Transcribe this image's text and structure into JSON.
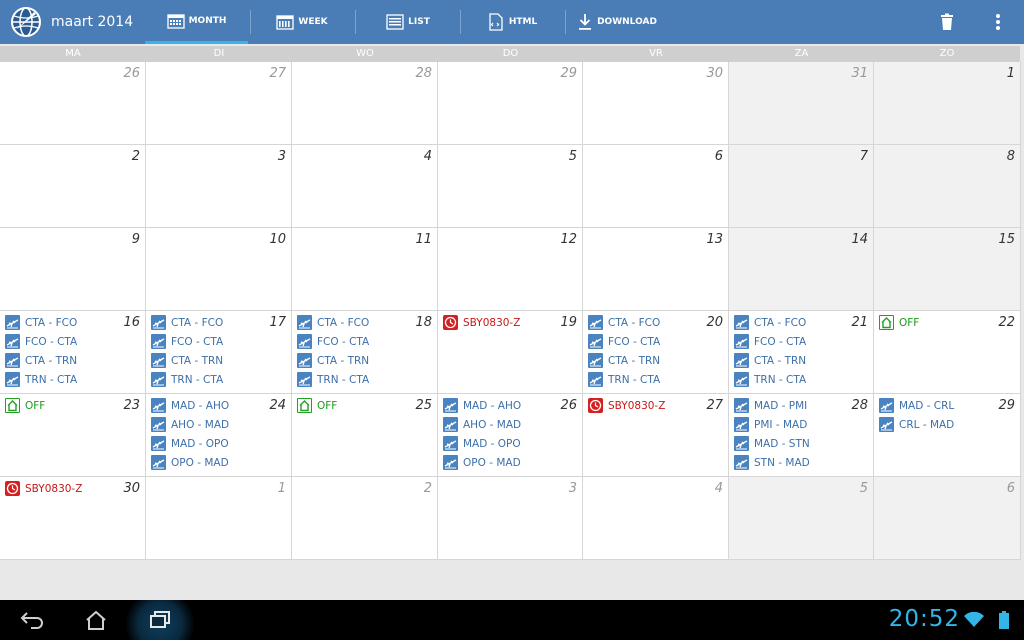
{
  "header": {
    "title": "maart 2014",
    "nav": [
      {
        "label": "MONTH",
        "icon": "calendar-month-icon",
        "active": true
      },
      {
        "label": "WEEK",
        "icon": "calendar-week-icon",
        "active": false
      },
      {
        "label": "LIST",
        "icon": "list-icon",
        "active": false
      },
      {
        "label": "HTML",
        "icon": "html-export-icon",
        "active": false
      },
      {
        "label": "DOWNLOAD",
        "icon": "download-icon",
        "active": false
      }
    ],
    "actions": [
      "trash-icon",
      "overflow-menu-icon"
    ]
  },
  "calendar": {
    "days_of_week": [
      "MA",
      "DI",
      "WO",
      "DO",
      "VR",
      "ZA",
      "ZO"
    ],
    "weeks": [
      [
        {
          "day": "26",
          "other": true,
          "events": []
        },
        {
          "day": "27",
          "other": true,
          "events": []
        },
        {
          "day": "28",
          "other": true,
          "events": []
        },
        {
          "day": "29",
          "other": true,
          "events": []
        },
        {
          "day": "30",
          "other": true,
          "events": []
        },
        {
          "day": "31",
          "other": true,
          "events": []
        },
        {
          "day": "1",
          "other": false,
          "events": []
        }
      ],
      [
        {
          "day": "2",
          "other": false,
          "events": []
        },
        {
          "day": "3",
          "other": false,
          "events": []
        },
        {
          "day": "4",
          "other": false,
          "events": []
        },
        {
          "day": "5",
          "other": false,
          "events": []
        },
        {
          "day": "6",
          "other": false,
          "events": []
        },
        {
          "day": "7",
          "other": false,
          "events": []
        },
        {
          "day": "8",
          "other": false,
          "events": []
        }
      ],
      [
        {
          "day": "9",
          "other": false,
          "events": []
        },
        {
          "day": "10",
          "other": false,
          "events": []
        },
        {
          "day": "11",
          "other": false,
          "events": []
        },
        {
          "day": "12",
          "other": false,
          "events": []
        },
        {
          "day": "13",
          "other": false,
          "events": []
        },
        {
          "day": "14",
          "other": false,
          "events": []
        },
        {
          "day": "15",
          "other": false,
          "events": []
        }
      ],
      [
        {
          "day": "16",
          "other": false,
          "events": [
            {
              "type": "flight",
              "label": "CTA - FCO"
            },
            {
              "type": "flight",
              "label": "FCO - CTA"
            },
            {
              "type": "flight",
              "label": "CTA - TRN"
            },
            {
              "type": "flight",
              "label": "TRN - CTA"
            }
          ]
        },
        {
          "day": "17",
          "other": false,
          "events": [
            {
              "type": "flight",
              "label": "CTA - FCO"
            },
            {
              "type": "flight",
              "label": "FCO - CTA"
            },
            {
              "type": "flight",
              "label": "CTA - TRN"
            },
            {
              "type": "flight",
              "label": "TRN - CTA"
            }
          ]
        },
        {
          "day": "18",
          "other": false,
          "events": [
            {
              "type": "flight",
              "label": "CTA - FCO"
            },
            {
              "type": "flight",
              "label": "FCO - CTA"
            },
            {
              "type": "flight",
              "label": "CTA - TRN"
            },
            {
              "type": "flight",
              "label": "TRN - CTA"
            }
          ]
        },
        {
          "day": "19",
          "other": false,
          "events": [
            {
              "type": "sby",
              "label": "SBY0830-Z"
            }
          ]
        },
        {
          "day": "20",
          "other": false,
          "events": [
            {
              "type": "flight",
              "label": "CTA - FCO"
            },
            {
              "type": "flight",
              "label": "FCO - CTA"
            },
            {
              "type": "flight",
              "label": "CTA - TRN"
            },
            {
              "type": "flight",
              "label": "TRN - CTA"
            }
          ]
        },
        {
          "day": "21",
          "other": false,
          "events": [
            {
              "type": "flight",
              "label": "CTA - FCO"
            },
            {
              "type": "flight",
              "label": "FCO - CTA"
            },
            {
              "type": "flight",
              "label": "CTA - TRN"
            },
            {
              "type": "flight",
              "label": "TRN - CTA"
            }
          ]
        },
        {
          "day": "22",
          "other": false,
          "events": [
            {
              "type": "off",
              "label": "OFF"
            }
          ]
        }
      ],
      [
        {
          "day": "23",
          "other": false,
          "events": [
            {
              "type": "off",
              "label": "OFF"
            }
          ]
        },
        {
          "day": "24",
          "other": false,
          "events": [
            {
              "type": "flight",
              "label": "MAD - AHO"
            },
            {
              "type": "flight",
              "label": "AHO - MAD"
            },
            {
              "type": "flight",
              "label": "MAD - OPO"
            },
            {
              "type": "flight",
              "label": "OPO - MAD"
            }
          ]
        },
        {
          "day": "25",
          "other": false,
          "events": [
            {
              "type": "off",
              "label": "OFF"
            }
          ]
        },
        {
          "day": "26",
          "other": false,
          "events": [
            {
              "type": "flight",
              "label": "MAD - AHO"
            },
            {
              "type": "flight",
              "label": "AHO - MAD"
            },
            {
              "type": "flight",
              "label": "MAD - OPO"
            },
            {
              "type": "flight",
              "label": "OPO - MAD"
            }
          ]
        },
        {
          "day": "27",
          "other": false,
          "events": [
            {
              "type": "sby",
              "label": "SBY0830-Z"
            }
          ]
        },
        {
          "day": "28",
          "other": false,
          "events": [
            {
              "type": "flight",
              "label": "MAD - PMI"
            },
            {
              "type": "flight",
              "label": "PMI - MAD"
            },
            {
              "type": "flight",
              "label": "MAD - STN"
            },
            {
              "type": "flight",
              "label": "STN - MAD"
            }
          ]
        },
        {
          "day": "29",
          "other": false,
          "events": [
            {
              "type": "flight",
              "label": "MAD - CRL"
            },
            {
              "type": "flight",
              "label": "CRL - MAD"
            }
          ]
        }
      ],
      [
        {
          "day": "30",
          "other": false,
          "events": [
            {
              "type": "sby",
              "label": "SBY0830-Z"
            }
          ]
        },
        {
          "day": "1",
          "other": true,
          "events": []
        },
        {
          "day": "2",
          "other": true,
          "events": []
        },
        {
          "day": "3",
          "other": true,
          "events": []
        },
        {
          "day": "4",
          "other": true,
          "events": []
        },
        {
          "day": "5",
          "other": true,
          "events": []
        },
        {
          "day": "6",
          "other": true,
          "events": []
        }
      ]
    ]
  },
  "system_bar": {
    "buttons": [
      "back-icon",
      "home-icon",
      "recent-apps-icon"
    ],
    "clock": "20:52",
    "status_icons": [
      "wifi-icon",
      "battery-icon"
    ]
  },
  "colors": {
    "accent": "#4a7db5",
    "flight": "#3d6fa8",
    "off": "#1a9a1a",
    "standby": "#c81818",
    "clock": "#33b5e5"
  }
}
